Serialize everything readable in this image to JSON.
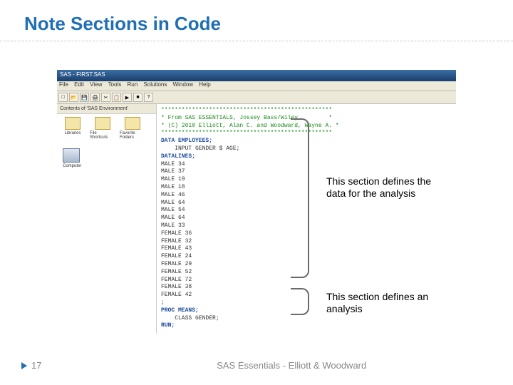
{
  "slide": {
    "title": "Note Sections in Code",
    "page_number": "17",
    "footer": "SAS Essentials - Elliott & Woodward"
  },
  "annotations": {
    "data_section": "This section defines the data for the analysis",
    "analysis_section": "This section defines an analysis"
  },
  "sas_window": {
    "titlebar": "SAS - FIRST.SAS",
    "menu": [
      "File",
      "Edit",
      "View",
      "Tools",
      "Run",
      "Solutions",
      "Window",
      "Help"
    ],
    "explorer": {
      "header": "Contents of 'SAS Environment'",
      "items": [
        "Libraries",
        "File Shortcuts",
        "Favorite Folders"
      ],
      "computer": "Computer"
    },
    "code": {
      "star_line": "**************************************************",
      "c1": "* From SAS ESSENTIALS, Jossey Bass/Wiley         *",
      "c2": "* (C) 2010 Elliott, Alan C. and Woodward, Wayne A. *",
      "data_stmt": "DATA EMPLOYEES;",
      "input": "    INPUT GENDER $ AGE;",
      "datalines": "DATALINES;",
      "rows": [
        "MALE 34",
        "MALE 37",
        "MALE 19",
        "MALE 18",
        "MALE 46",
        "MALE 64",
        "MALE 54",
        "MALE 64",
        "MALE 33",
        "FEMALE 36",
        "FEMALE 32",
        "FEMALE 43",
        "FEMALE 24",
        "FEMALE 29",
        "FEMALE 52",
        "FEMALE 72",
        "FEMALE 38",
        "FEMALE 42"
      ],
      "semicolon": ";",
      "proc": "PROC MEANS;",
      "class": "    CLASS GENDER;",
      "run": "RUN;"
    }
  }
}
